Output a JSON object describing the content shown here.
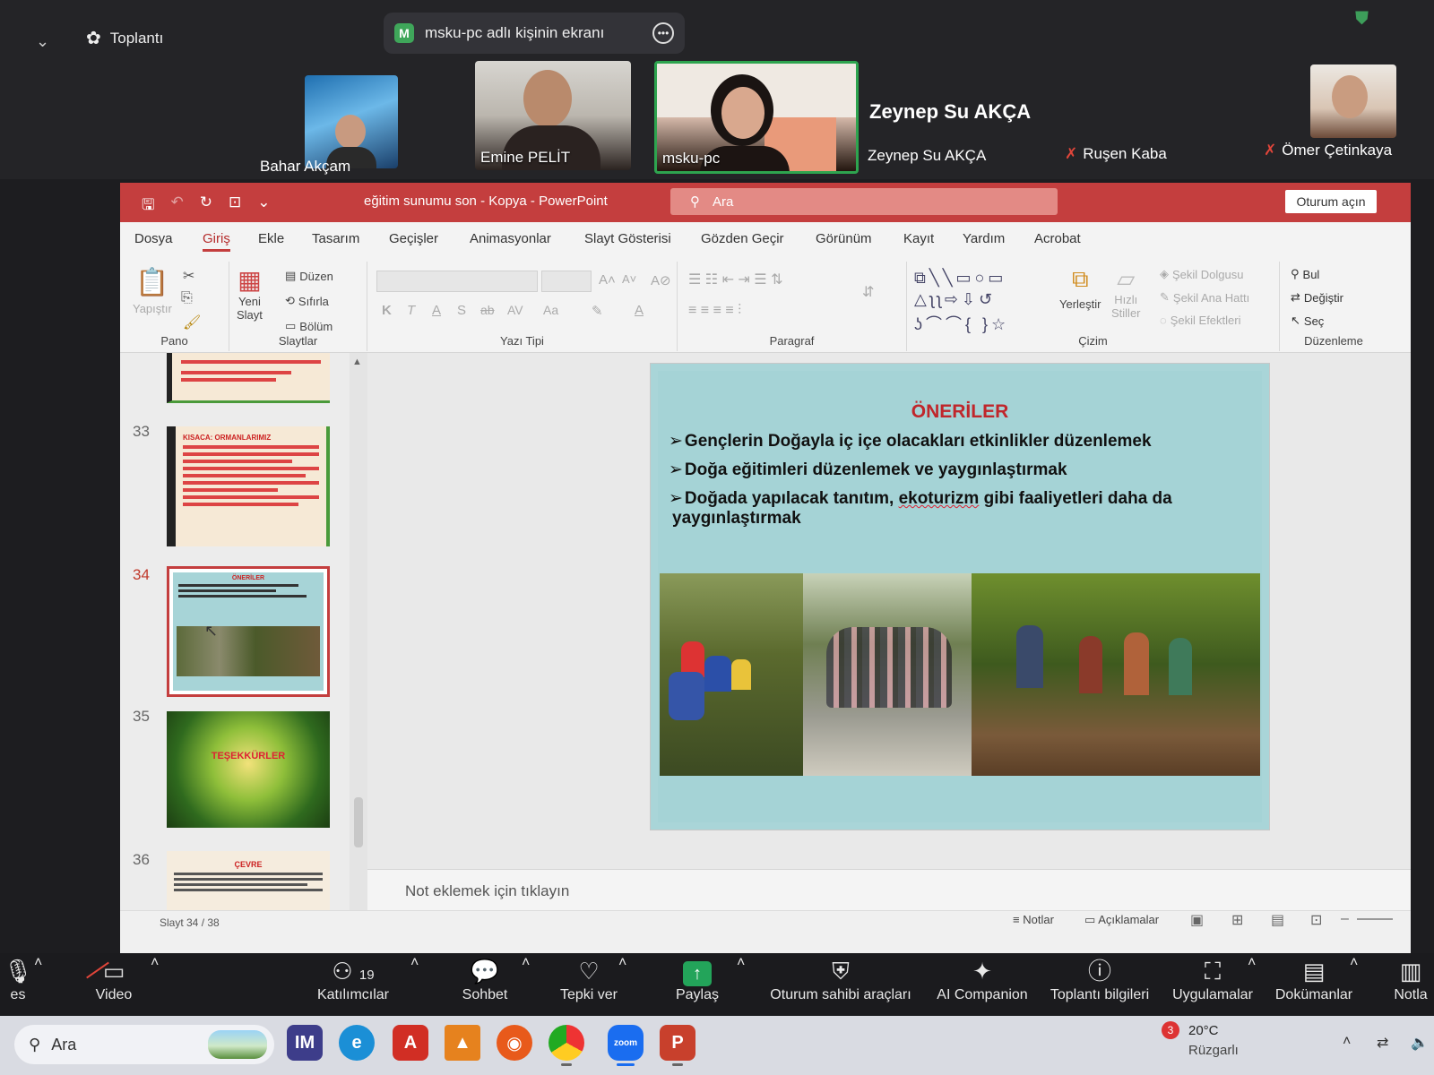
{
  "zoom": {
    "meeting_label": "Toplantı",
    "share_banner": "msku-pc adlı kişinin ekranı",
    "participants": [
      {
        "name": "Bahar Akçam"
      },
      {
        "name": "Emine PELİT"
      },
      {
        "name": "msku-pc"
      },
      {
        "name": "Zeynep Su AKÇA"
      },
      {
        "name": "Ruşen Kaba"
      },
      {
        "name": "Ömer Çetinkaya"
      }
    ],
    "active_speaker_big": "Zeynep Su AKÇA",
    "toolbar": {
      "audio_partial": "es",
      "video": "Video",
      "participants": "Katılımcılar",
      "participants_count": "19",
      "chat": "Sohbet",
      "react": "Tepki ver",
      "share": "Paylaş",
      "host_tools": "Oturum sahibi araçları",
      "ai": "AI Companion",
      "meeting_info": "Toplantı bilgileri",
      "apps": "Uygulamalar",
      "docs": "Dokümanlar",
      "notes_partial": "Notla"
    }
  },
  "ppt": {
    "title": "eğitim sunumu son - Kopya  -  PowerPoint",
    "search_placeholder": "Ara",
    "signin": "Oturum açın",
    "tabs": [
      "Dosya",
      "Giriş",
      "Ekle",
      "Tasarım",
      "Geçişler",
      "Animasyonlar",
      "Slayt Gösterisi",
      "Gözden Geçir",
      "Görünüm",
      "Kayıt",
      "Yardım",
      "Acrobat"
    ],
    "ribbon": {
      "paste": "Yapıştır",
      "clipboard_group": "Pano",
      "new_slide_1": "Yeni",
      "new_slide_2": "Slayt",
      "layout": "Düzen",
      "reset": "Sıfırla",
      "section": "Bölüm",
      "slides_group": "Slaytlar",
      "font_group": "Yazı Tipi",
      "paragraph_group": "Paragraf",
      "arrange": "Yerleştir",
      "quick_styles_1": "Hızlı",
      "quick_styles_2": "Stiller",
      "shape_fill": "Şekil Dolgusu",
      "shape_outline": "Şekil Ana Hattı",
      "shape_effects": "Şekil Efektleri",
      "drawing_group": "Çizim",
      "find": "Bul",
      "replace": "Değiştir",
      "select": "Seç",
      "editing_group": "Düzenleme",
      "bold": "K",
      "italic": "T",
      "underline": "A",
      "strike": "S",
      "spacing": "AV",
      "case": "Aa"
    },
    "thumbnails": [
      {
        "num": "33",
        "heading": "KISACA: ORMANLARIMIZ"
      },
      {
        "num": "34",
        "heading": "ÖNERİLER"
      },
      {
        "num": "35",
        "heading": "TEŞEKKÜRLER"
      },
      {
        "num": "36",
        "heading": "ÇEVRE"
      }
    ],
    "slide": {
      "title": "ÖNERİLER",
      "bullet1": "Gençlerin Doğayla iç içe olacakları etkinlikler düzenlemek",
      "bullet2": "Doğa eğitimleri düzenlemek ve yaygınlaştırmak",
      "bullet3_a": "Doğada yapılacak tanıtım, ",
      "bullet3_b": "ekoturizm",
      "bullet3_c": " gibi faaliyetleri daha da",
      "bullet3_d": "yaygınlaştırmak"
    },
    "notes_placeholder": "Not eklemek için tıklayın",
    "status": {
      "slide_count": "Slayt 34 / 38",
      "notes": "Notlar",
      "comments": "Açıklamalar"
    }
  },
  "taskbar": {
    "search": "Ara",
    "weather_temp": "20°C",
    "weather_desc": "Rüzgarlı",
    "notif_count": "3"
  }
}
